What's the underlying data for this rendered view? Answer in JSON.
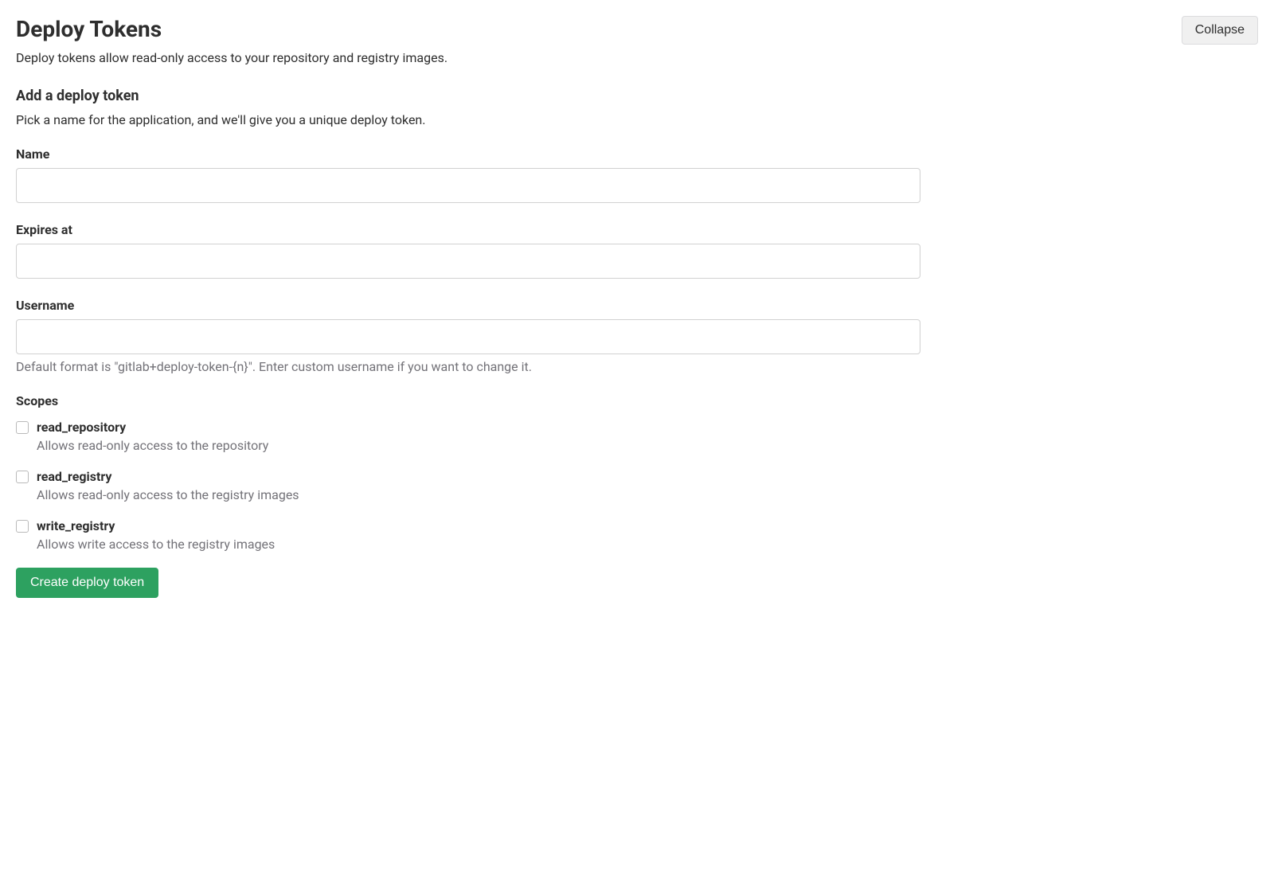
{
  "section": {
    "title": "Deploy Tokens",
    "description": "Deploy tokens allow read-only access to your repository and registry images.",
    "collapse_label": "Collapse"
  },
  "form": {
    "heading": "Add a deploy token",
    "description": "Pick a name for the application, and we'll give you a unique deploy token.",
    "name_label": "Name",
    "name_value": "",
    "expires_label": "Expires at",
    "expires_value": "",
    "username_label": "Username",
    "username_value": "",
    "username_help": "Default format is \"gitlab+deploy-token-{n}\". Enter custom username if you want to change it.",
    "scopes_label": "Scopes",
    "scopes": [
      {
        "name": "read_repository",
        "description": "Allows read-only access to the repository"
      },
      {
        "name": "read_registry",
        "description": "Allows read-only access to the registry images"
      },
      {
        "name": "write_registry",
        "description": "Allows write access to the registry images"
      }
    ],
    "submit_label": "Create deploy token"
  }
}
